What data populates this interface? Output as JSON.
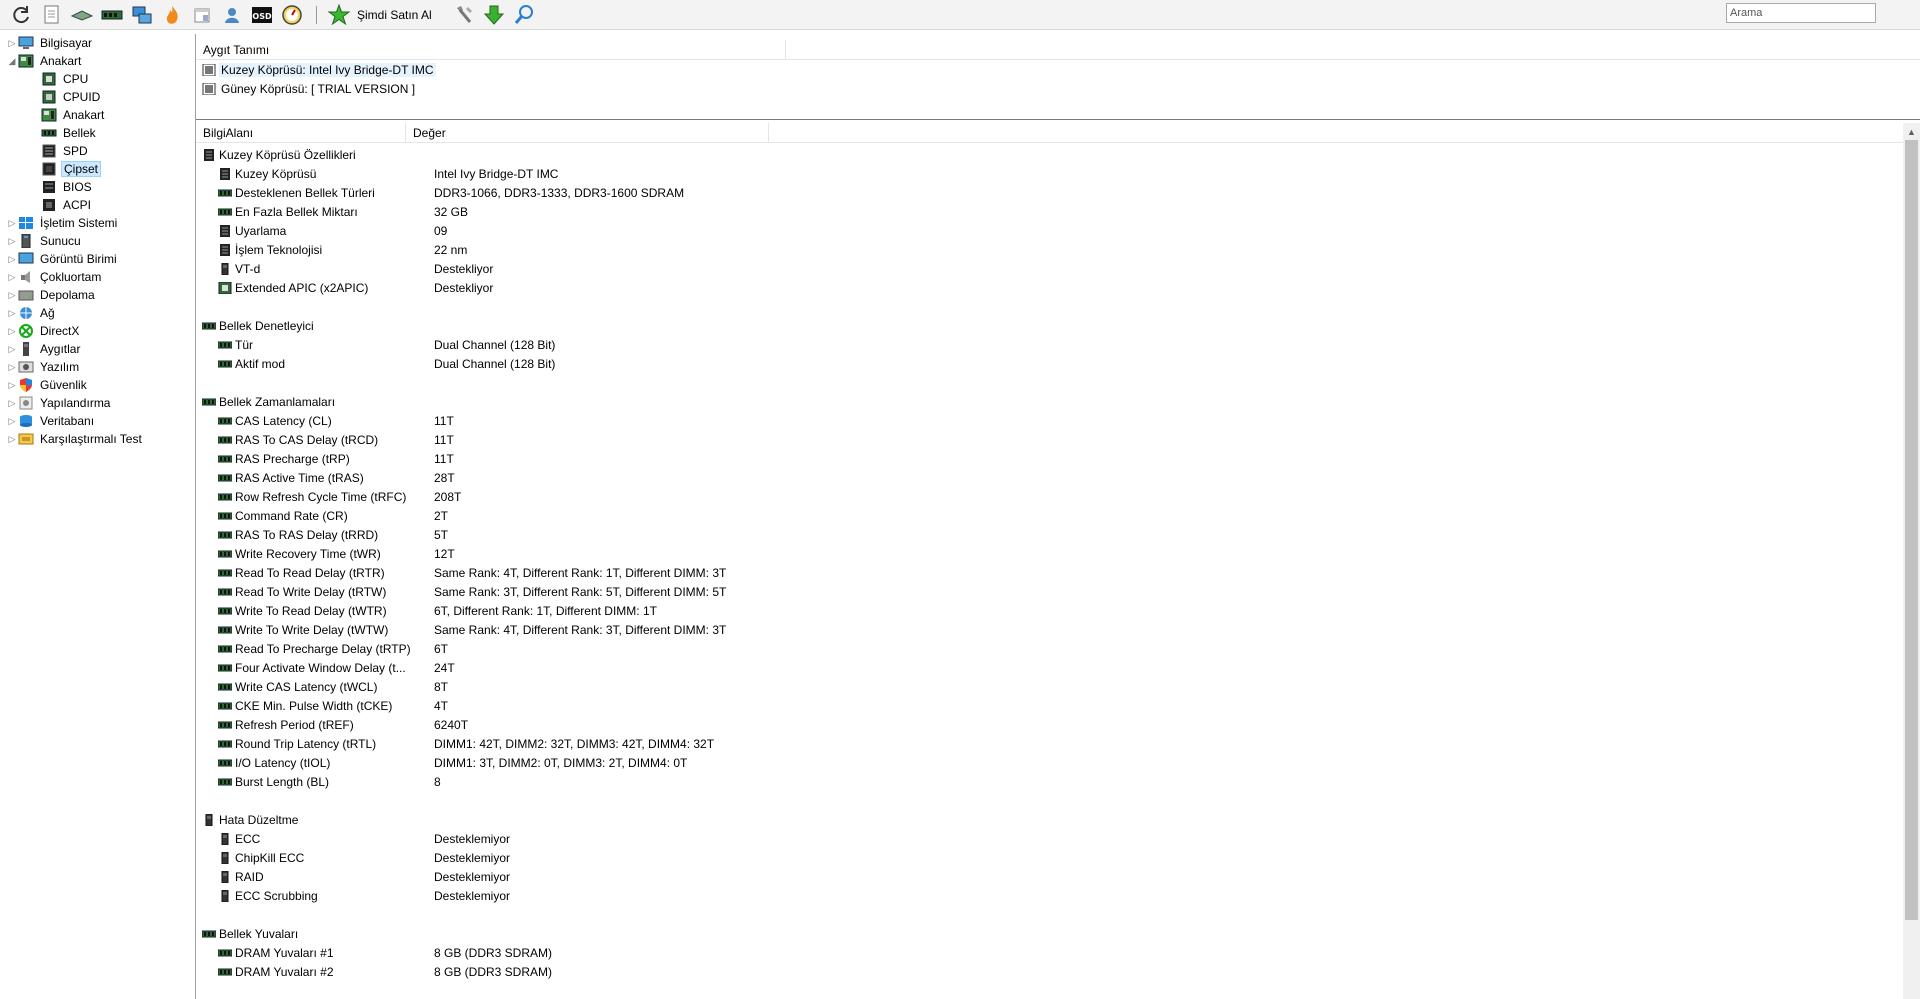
{
  "toolbar": {
    "buy_label": "Şimdi Satın Al",
    "search_placeholder": "Arama"
  },
  "tree": {
    "items": [
      {
        "label": "Bilgisayar",
        "level": 0,
        "expander": "▷",
        "icon": "computer-icon"
      },
      {
        "label": "Anakart",
        "level": 0,
        "expander": "◢",
        "icon": "motherboard-icon"
      },
      {
        "label": "CPU",
        "level": 1,
        "expander": "",
        "icon": "cpu-icon"
      },
      {
        "label": "CPUID",
        "level": 1,
        "expander": "",
        "icon": "cpuid-icon"
      },
      {
        "label": "Anakart",
        "level": 1,
        "expander": "",
        "icon": "motherboard-icon"
      },
      {
        "label": "Bellek",
        "level": 1,
        "expander": "",
        "icon": "memory-icon"
      },
      {
        "label": "SPD",
        "level": 1,
        "expander": "",
        "icon": "spd-icon"
      },
      {
        "label": "Çipset",
        "level": 1,
        "expander": "",
        "icon": "chipset-icon",
        "selected": true
      },
      {
        "label": "BIOS",
        "level": 1,
        "expander": "",
        "icon": "bios-icon"
      },
      {
        "label": "ACPI",
        "level": 1,
        "expander": "",
        "icon": "acpi-icon"
      },
      {
        "label": "İşletim Sistemi",
        "level": 0,
        "expander": "▷",
        "icon": "windows-icon"
      },
      {
        "label": "Sunucu",
        "level": 0,
        "expander": "▷",
        "icon": "server-icon"
      },
      {
        "label": "Görüntü Birimi",
        "level": 0,
        "expander": "▷",
        "icon": "display-icon"
      },
      {
        "label": "Çokluortam",
        "level": 0,
        "expander": "▷",
        "icon": "multimedia-icon"
      },
      {
        "label": "Depolama",
        "level": 0,
        "expander": "▷",
        "icon": "storage-icon"
      },
      {
        "label": "Ağ",
        "level": 0,
        "expander": "▷",
        "icon": "network-icon"
      },
      {
        "label": "DirectX",
        "level": 0,
        "expander": "▷",
        "icon": "directx-icon"
      },
      {
        "label": "Aygıtlar",
        "level": 0,
        "expander": "▷",
        "icon": "devices-icon"
      },
      {
        "label": "Yazılım",
        "level": 0,
        "expander": "▷",
        "icon": "software-icon"
      },
      {
        "label": "Güvenlik",
        "level": 0,
        "expander": "▷",
        "icon": "security-icon"
      },
      {
        "label": "Yapılandırma",
        "level": 0,
        "expander": "▷",
        "icon": "config-icon"
      },
      {
        "label": "Veritabanı",
        "level": 0,
        "expander": "▷",
        "icon": "database-icon"
      },
      {
        "label": "Karşılaştırmalı Test",
        "level": 0,
        "expander": "▷",
        "icon": "benchmark-icon"
      }
    ]
  },
  "device_panel": {
    "header": "Aygıt Tanımı",
    "rows": [
      {
        "label": "Kuzey Köprüsü: Intel Ivy Bridge-DT IMC",
        "selected": true
      },
      {
        "label": "Güney Köprüsü: [ TRIAL VERSION ]",
        "selected": false
      }
    ]
  },
  "info_panel": {
    "col_field": "BilgiAlanı",
    "col_value": "Değer",
    "rows": [
      {
        "type": "group",
        "field": "Kuzey Köprüsü Özellikleri",
        "icon": "chip"
      },
      {
        "type": "item",
        "field": "Kuzey Köprüsü",
        "value": "Intel Ivy Bridge-DT IMC",
        "icon": "chip"
      },
      {
        "type": "item",
        "field": "Desteklenen Bellek Türleri",
        "value": "DDR3-1066, DDR3-1333, DDR3-1600 SDRAM",
        "icon": "ram"
      },
      {
        "type": "item",
        "field": "En Fazla Bellek Miktarı",
        "value": "32 GB",
        "icon": "ram"
      },
      {
        "type": "item",
        "field": "Uyarlama",
        "value": "09",
        "icon": "chip"
      },
      {
        "type": "item",
        "field": "İşlem Teknolojisi",
        "value": "22 nm",
        "icon": "chip"
      },
      {
        "type": "item",
        "field": "VT-d",
        "value": "Destekliyor",
        "icon": "stick"
      },
      {
        "type": "item",
        "field": "Extended APIC (x2APIC)",
        "value": "Destekliyor",
        "icon": "cpu"
      },
      {
        "type": "blank"
      },
      {
        "type": "group",
        "field": "Bellek Denetleyici",
        "icon": "ram"
      },
      {
        "type": "item",
        "field": "Tür",
        "value": "Dual Channel  (128 Bit)",
        "icon": "ram"
      },
      {
        "type": "item",
        "field": "Aktif mod",
        "value": "Dual Channel  (128 Bit)",
        "icon": "ram"
      },
      {
        "type": "blank"
      },
      {
        "type": "group",
        "field": "Bellek Zamanlamaları",
        "icon": "ram"
      },
      {
        "type": "item",
        "field": "CAS Latency (CL)",
        "value": "11T",
        "icon": "ram"
      },
      {
        "type": "item",
        "field": "RAS To CAS Delay (tRCD)",
        "value": "11T",
        "icon": "ram"
      },
      {
        "type": "item",
        "field": "RAS Precharge (tRP)",
        "value": "11T",
        "icon": "ram"
      },
      {
        "type": "item",
        "field": "RAS Active Time (tRAS)",
        "value": "28T",
        "icon": "ram"
      },
      {
        "type": "item",
        "field": "Row Refresh Cycle Time (tRFC)",
        "value": "208T",
        "icon": "ram"
      },
      {
        "type": "item",
        "field": "Command Rate (CR)",
        "value": "2T",
        "icon": "ram"
      },
      {
        "type": "item",
        "field": "RAS To RAS Delay (tRRD)",
        "value": "5T",
        "icon": "ram"
      },
      {
        "type": "item",
        "field": "Write Recovery Time (tWR)",
        "value": "12T",
        "icon": "ram"
      },
      {
        "type": "item",
        "field": "Read To Read Delay (tRTR)",
        "value": "Same Rank: 4T, Different Rank: 1T, Different DIMM: 3T",
        "icon": "ram"
      },
      {
        "type": "item",
        "field": "Read To Write Delay (tRTW)",
        "value": "Same Rank: 3T, Different Rank: 5T, Different DIMM: 5T",
        "icon": "ram"
      },
      {
        "type": "item",
        "field": "Write To Read Delay (tWTR)",
        "value": "6T, Different Rank: 1T, Different DIMM: 1T",
        "icon": "ram"
      },
      {
        "type": "item",
        "field": "Write To Write Delay (tWTW)",
        "value": "Same Rank: 4T, Different Rank: 3T, Different DIMM: 3T",
        "icon": "ram"
      },
      {
        "type": "item",
        "field": "Read To Precharge Delay (tRTP)",
        "value": "6T",
        "icon": "ram"
      },
      {
        "type": "item",
        "field": "Four Activate Window Delay (t...",
        "value": "24T",
        "icon": "ram"
      },
      {
        "type": "item",
        "field": "Write CAS Latency (tWCL)",
        "value": "8T",
        "icon": "ram"
      },
      {
        "type": "item",
        "field": "CKE Min. Pulse Width (tCKE)",
        "value": "4T",
        "icon": "ram"
      },
      {
        "type": "item",
        "field": "Refresh Period (tREF)",
        "value": "6240T",
        "icon": "ram"
      },
      {
        "type": "item",
        "field": "Round Trip Latency (tRTL)",
        "value": "DIMM1: 42T, DIMM2: 32T, DIMM3: 42T, DIMM4: 32T",
        "icon": "ram"
      },
      {
        "type": "item",
        "field": "I/O Latency (tIOL)",
        "value": "DIMM1: 3T, DIMM2: 0T, DIMM3: 2T, DIMM4: 0T",
        "icon": "ram"
      },
      {
        "type": "item",
        "field": "Burst Length (BL)",
        "value": "8",
        "icon": "ram"
      },
      {
        "type": "blank"
      },
      {
        "type": "group",
        "field": "Hata Düzeltme",
        "icon": "stick"
      },
      {
        "type": "item",
        "field": "ECC",
        "value": "Desteklemiyor",
        "icon": "stick"
      },
      {
        "type": "item",
        "field": "ChipKill ECC",
        "value": "Desteklemiyor",
        "icon": "stick"
      },
      {
        "type": "item",
        "field": "RAID",
        "value": "Desteklemiyor",
        "icon": "stick"
      },
      {
        "type": "item",
        "field": "ECC Scrubbing",
        "value": "Desteklemiyor",
        "icon": "stick"
      },
      {
        "type": "blank"
      },
      {
        "type": "group",
        "field": "Bellek Yuvaları",
        "icon": "ram"
      },
      {
        "type": "item",
        "field": "DRAM Yuvaları #1",
        "value": "8 GB  (DDR3 SDRAM)",
        "icon": "ram"
      },
      {
        "type": "item",
        "field": "DRAM Yuvaları #2",
        "value": "8 GB  (DDR3 SDRAM)",
        "icon": "ram"
      }
    ]
  }
}
